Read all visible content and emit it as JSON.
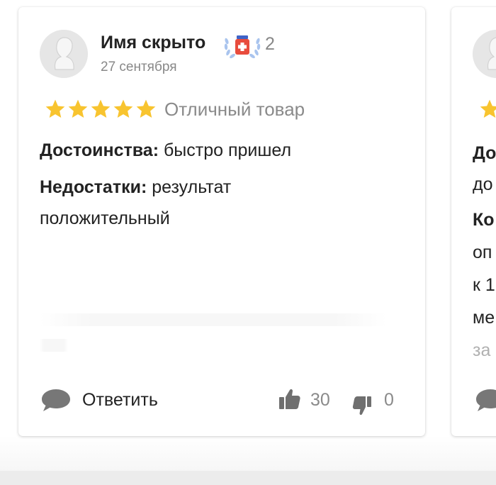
{
  "colors": {
    "star": "#f8c42f",
    "badge": "#e84c3d",
    "badge_laurel": "#9fbce8",
    "muted": "#8a8a8a",
    "icon_gray": "#6f6f6f"
  },
  "review": {
    "author": "Имя скрыто",
    "badge_count": "2",
    "date": "27 сентября",
    "rating": 5,
    "rating_text": "Отличный товар",
    "pros_label": "Достоинства:",
    "pros_text": " быстро пришел",
    "cons_label": "Недостатки:",
    "cons_text": " результат положительный",
    "reply_label": "Ответить",
    "likes": "30",
    "dislikes": "0",
    "icons": {
      "avatar": "avatar-placeholder-icon",
      "badge": "expert-badge-icon",
      "reply": "speech-bubble-icon",
      "like": "thumbs-up-icon",
      "dislike": "thumbs-down-icon"
    }
  },
  "next_review": {
    "lines": [
      "До",
      "до",
      "Ко",
      "оп",
      "к 1",
      "ме",
      "за"
    ]
  }
}
